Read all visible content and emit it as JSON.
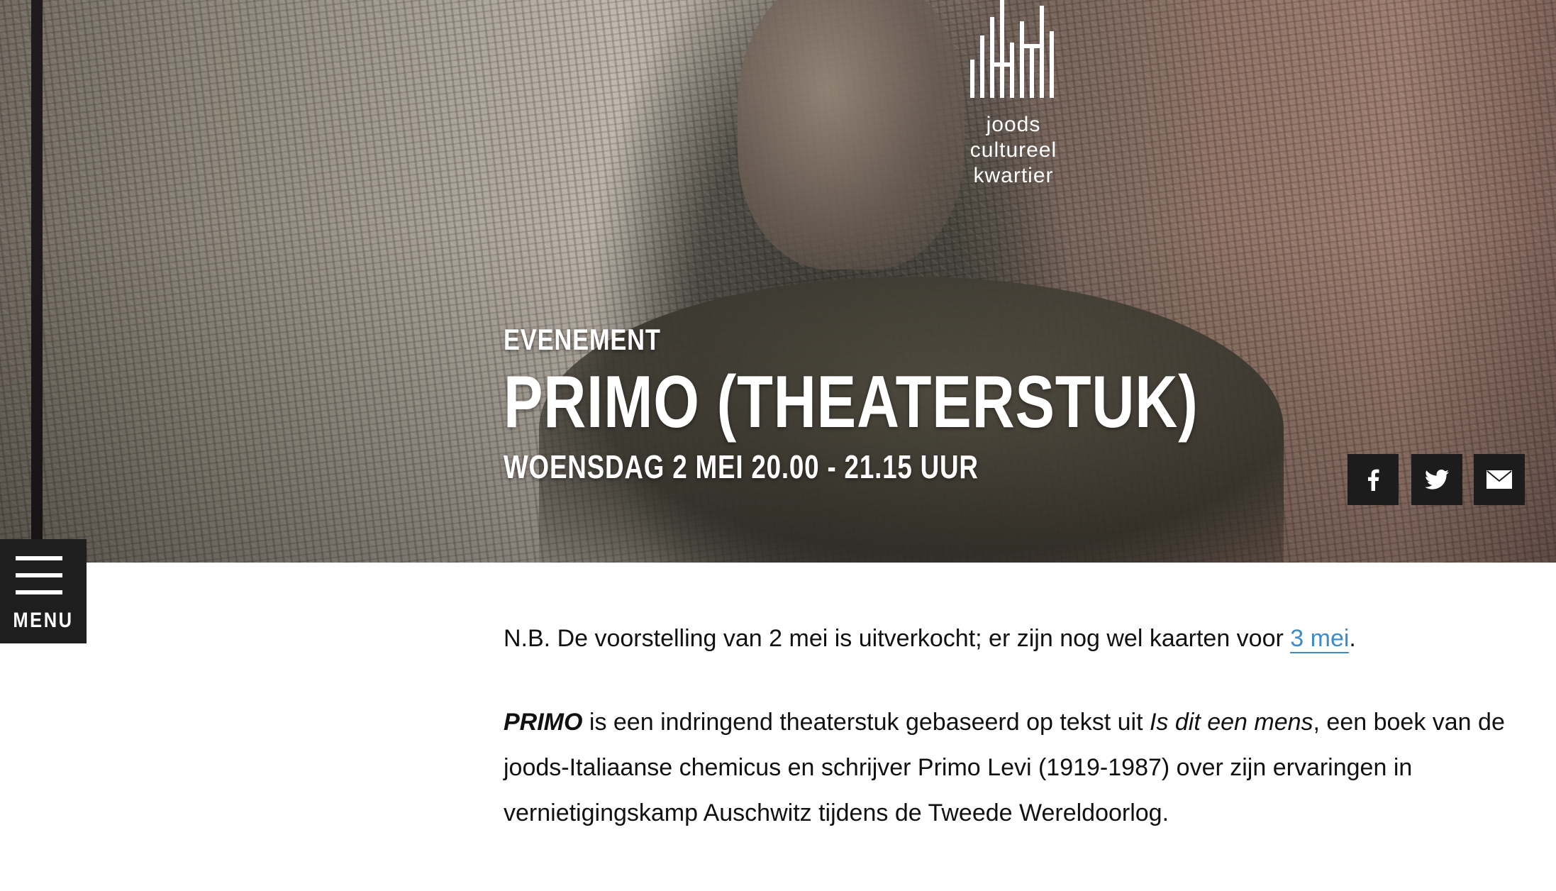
{
  "logo": {
    "lines": [
      "joods",
      "cultureel",
      "kwartier"
    ],
    "icon": "jck-logo-icon"
  },
  "hero": {
    "event_type": "EVENEMENT",
    "title": "PRIMO (THEATERSTUK)",
    "date": "WOENSDAG 2 MEI 20.00 - 21.15 UUR"
  },
  "share": {
    "facebook_icon": "facebook-icon",
    "twitter_icon": "twitter-icon",
    "mail_icon": "mail-icon"
  },
  "menu": {
    "label": "MENU",
    "icon": "hamburger-icon"
  },
  "content": {
    "notice_text": "N.B. De voorstelling van 2 mei is uitverkocht; er zijn nog wel kaarten voor ",
    "notice_link": "3 mei",
    "notice_end": ".",
    "intro_title": "PRIMO",
    "intro_text_1": " is een indringend theaterstuk gebaseerd op tekst uit ",
    "intro_book": "Is dit een mens",
    "intro_text_2": ", een boek van de joods-Italiaanse chemicus en schrijver Primo Levi (1919-1987) over zijn ervaringen in vernietigingskamp Auschwitz tijdens de Tweede Wereldoorlog."
  },
  "colors": {
    "link": "#3f8bc7",
    "dark_button": "#1c1c1c",
    "text": "#111111"
  }
}
